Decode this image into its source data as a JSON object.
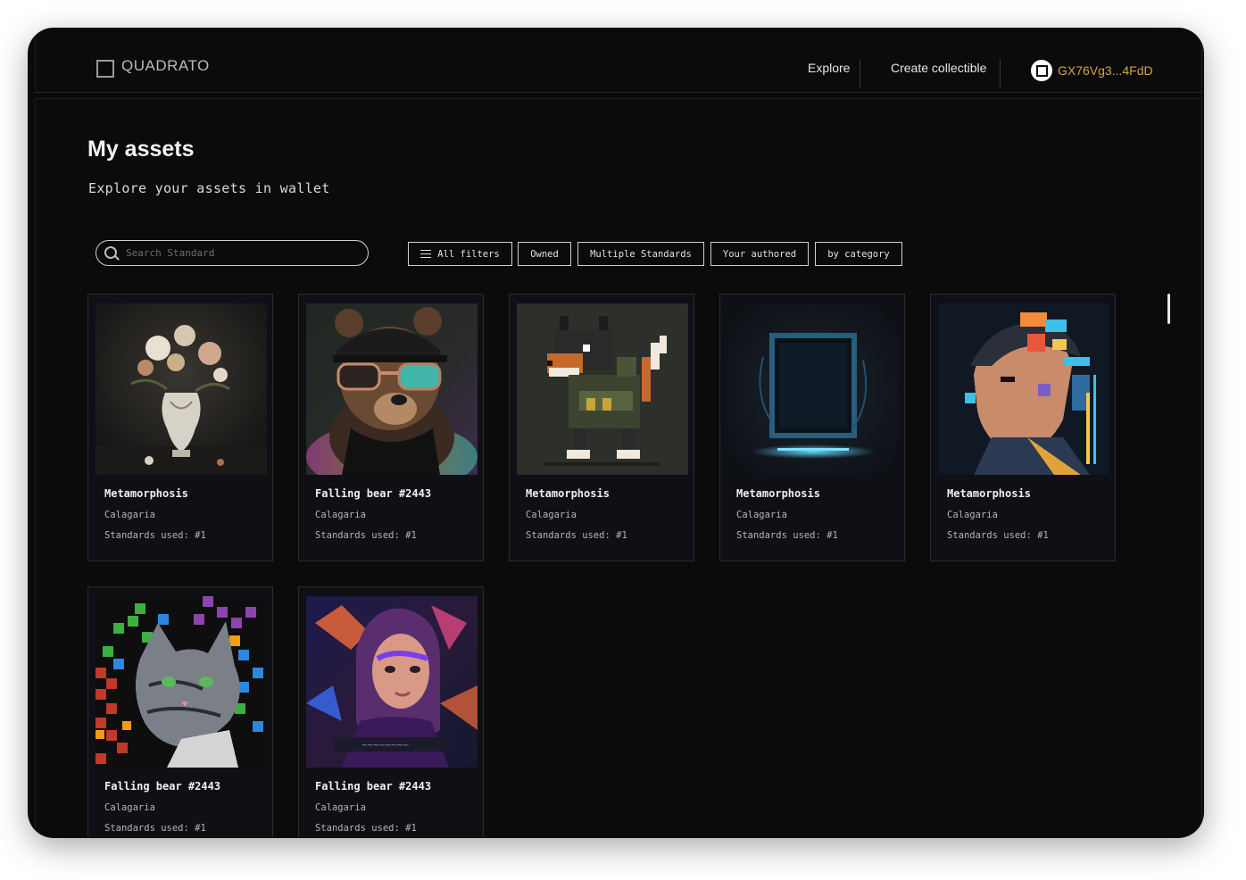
{
  "app": {
    "brand": "QUADRATO"
  },
  "nav": {
    "explore": "Explore",
    "create": "Create collectible",
    "wallet_address": "GX76Vg3...4FdD"
  },
  "page": {
    "title": "My assets",
    "subtitle": "Explore your assets in wallet"
  },
  "search": {
    "placeholder": "Search Standard",
    "value": ""
  },
  "filters": {
    "all": "All filters",
    "owned": "Owned",
    "multiple": "Multiple Standards",
    "authored": "Your authored",
    "category": "by category"
  },
  "assets": [
    {
      "name": "Metamorphosis",
      "creator": "Calagaria",
      "standards": "Standards used: #1",
      "art": "flower-vase"
    },
    {
      "name": "Falling bear #2443",
      "creator": "Calagaria",
      "standards": "Standards used: #1",
      "art": "bear-with-glasses"
    },
    {
      "name": "Metamorphosis",
      "creator": "Calagaria",
      "standards": "Standards used: #1",
      "art": "pixel-dog"
    },
    {
      "name": "Metamorphosis",
      "creator": "Calagaria",
      "standards": "Standards used: #1",
      "art": "glowing-portal"
    },
    {
      "name": "Metamorphosis",
      "creator": "Calagaria",
      "standards": "Standards used: #1",
      "art": "glitch-man-portrait"
    },
    {
      "name": "Falling bear #2443",
      "creator": "Calagaria",
      "standards": "Standards used: #1",
      "art": "pixel-cat"
    },
    {
      "name": "Falling bear #2443",
      "creator": "Calagaria",
      "standards": "Standards used: #1",
      "art": "neon-woman-portrait"
    }
  ],
  "colors": {
    "background": "#0b0b0c",
    "card": "#0f0f16",
    "accent_wallet": "#d6a43a"
  }
}
